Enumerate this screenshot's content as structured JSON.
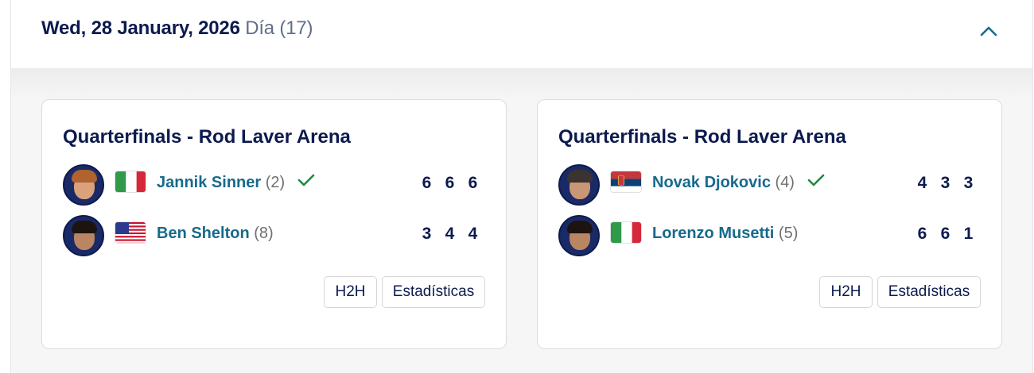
{
  "day": {
    "date": "Wed, 28 January, 2026",
    "label": "Día",
    "number": "(17)"
  },
  "icons": {
    "collapse": "chevron-up-icon",
    "winner": "check-icon"
  },
  "colors": {
    "title": "#0c1a4e",
    "player_link": "#176a8c",
    "check": "#1f8a3b"
  },
  "matches": [
    {
      "title": "Quarterfinals - Rod Laver Arena",
      "players": [
        {
          "name": "Jannik Sinner",
          "seed": "(2)",
          "country": "Italy",
          "winner": true,
          "sets": [
            "6",
            "6",
            "6"
          ]
        },
        {
          "name": "Ben Shelton",
          "seed": "(8)",
          "country": "USA",
          "winner": false,
          "sets": [
            "3",
            "4",
            "4"
          ]
        }
      ],
      "h2h_label": "H2H",
      "stats_label": "Estadísticas"
    },
    {
      "title": "Quarterfinals - Rod Laver Arena",
      "players": [
        {
          "name": "Novak Djokovic",
          "seed": "(4)",
          "country": "Serbia",
          "winner": true,
          "sets": [
            "4",
            "3",
            "3"
          ]
        },
        {
          "name": "Lorenzo Musetti",
          "seed": "(5)",
          "country": "Italy",
          "winner": false,
          "sets": [
            "6",
            "6",
            "1"
          ]
        }
      ],
      "h2h_label": "H2H",
      "stats_label": "Estadísticas"
    }
  ]
}
